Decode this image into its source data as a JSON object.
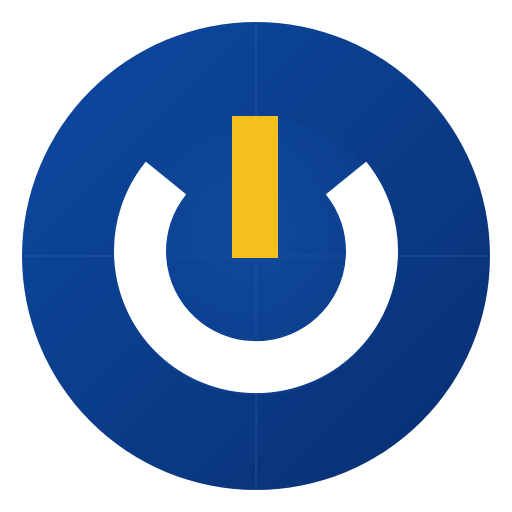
{
  "icon": {
    "name": "power-icon",
    "colors": {
      "background": "#ffffff",
      "circle_fill": "#0b3f91",
      "circle_fill_dark": "#0a3279",
      "inner_disc": "#10489e",
      "ring": "#ffffff",
      "bar": "#f7bf1c",
      "grid_line": "#2a5aa3"
    }
  }
}
